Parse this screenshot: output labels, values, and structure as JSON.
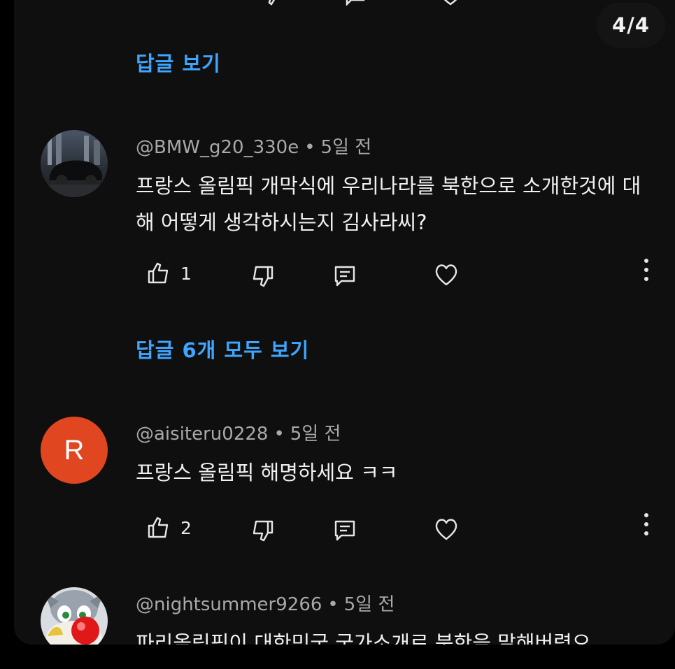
{
  "page_indicator": "4/4",
  "reply_links": {
    "first": "답글 보기",
    "second": "답글 6개 모두 보기"
  },
  "comments": [
    {
      "handle": "@BMW_g20_330e",
      "time": "5일 전",
      "text": "프랑스 올림픽 개막식에 우리나라를 북한으로 소개한것에 대해 어떻게 생각하시는지 김사라씨?",
      "likes": "1",
      "avatar_type": "photo-car"
    },
    {
      "handle": "@aisiteru0228",
      "time": "5일 전",
      "text": "프랑스 올림픽 해명하세요 ㅋㅋ",
      "likes": "2",
      "avatar_letter": "R",
      "avatar_color": "#e0461f"
    },
    {
      "handle": "@nightsummer9266",
      "time": "5일 전",
      "text": "파리올림픽이 대한민국 국가소개로 북한을 말해버렸으",
      "avatar_type": "cartoon-clown"
    }
  ],
  "colors": {
    "link": "#3ea6ff",
    "background": "#0f0f0f",
    "meta_text": "#a9a9a9",
    "body_text": "#f1f1f1"
  },
  "icons": [
    "thumbs-up-icon",
    "thumbs-down-icon",
    "reply-icon",
    "heart-icon",
    "more-vertical-icon"
  ]
}
